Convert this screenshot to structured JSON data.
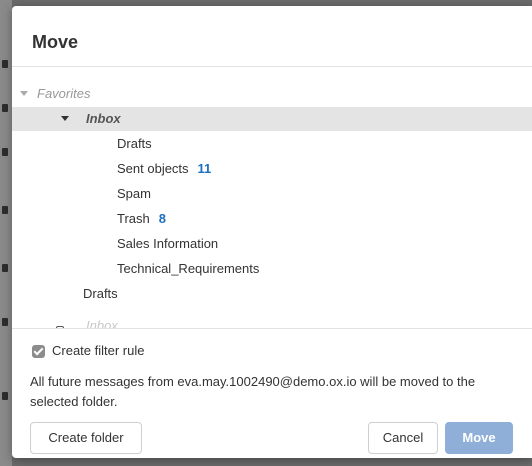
{
  "dialog": {
    "title": "Move"
  },
  "tree": {
    "favorites_label": "Favorites",
    "inbox_label": "Inbox",
    "children": [
      {
        "label": "Drafts",
        "count": ""
      },
      {
        "label": "Sent objects",
        "count": "11"
      },
      {
        "label": "Spam",
        "count": ""
      },
      {
        "label": "Trash",
        "count": "8"
      },
      {
        "label": "Sales Information",
        "count": ""
      },
      {
        "label": "Technical_Requirements",
        "count": ""
      }
    ],
    "favorites_drafts_label": "Drafts",
    "cutoff_label": "Inbox"
  },
  "filter": {
    "checkbox_label": "Create filter rule",
    "checked": true,
    "description": "All future messages from eva.may.1002490@demo.ox.io will be moved to the selected folder."
  },
  "buttons": {
    "create_folder": "Create folder",
    "cancel": "Cancel",
    "move": "Move"
  },
  "colors": {
    "accent": "#1c6fbd",
    "primary_button": "#8fafd9",
    "selected_row": "#e4e4e4"
  }
}
